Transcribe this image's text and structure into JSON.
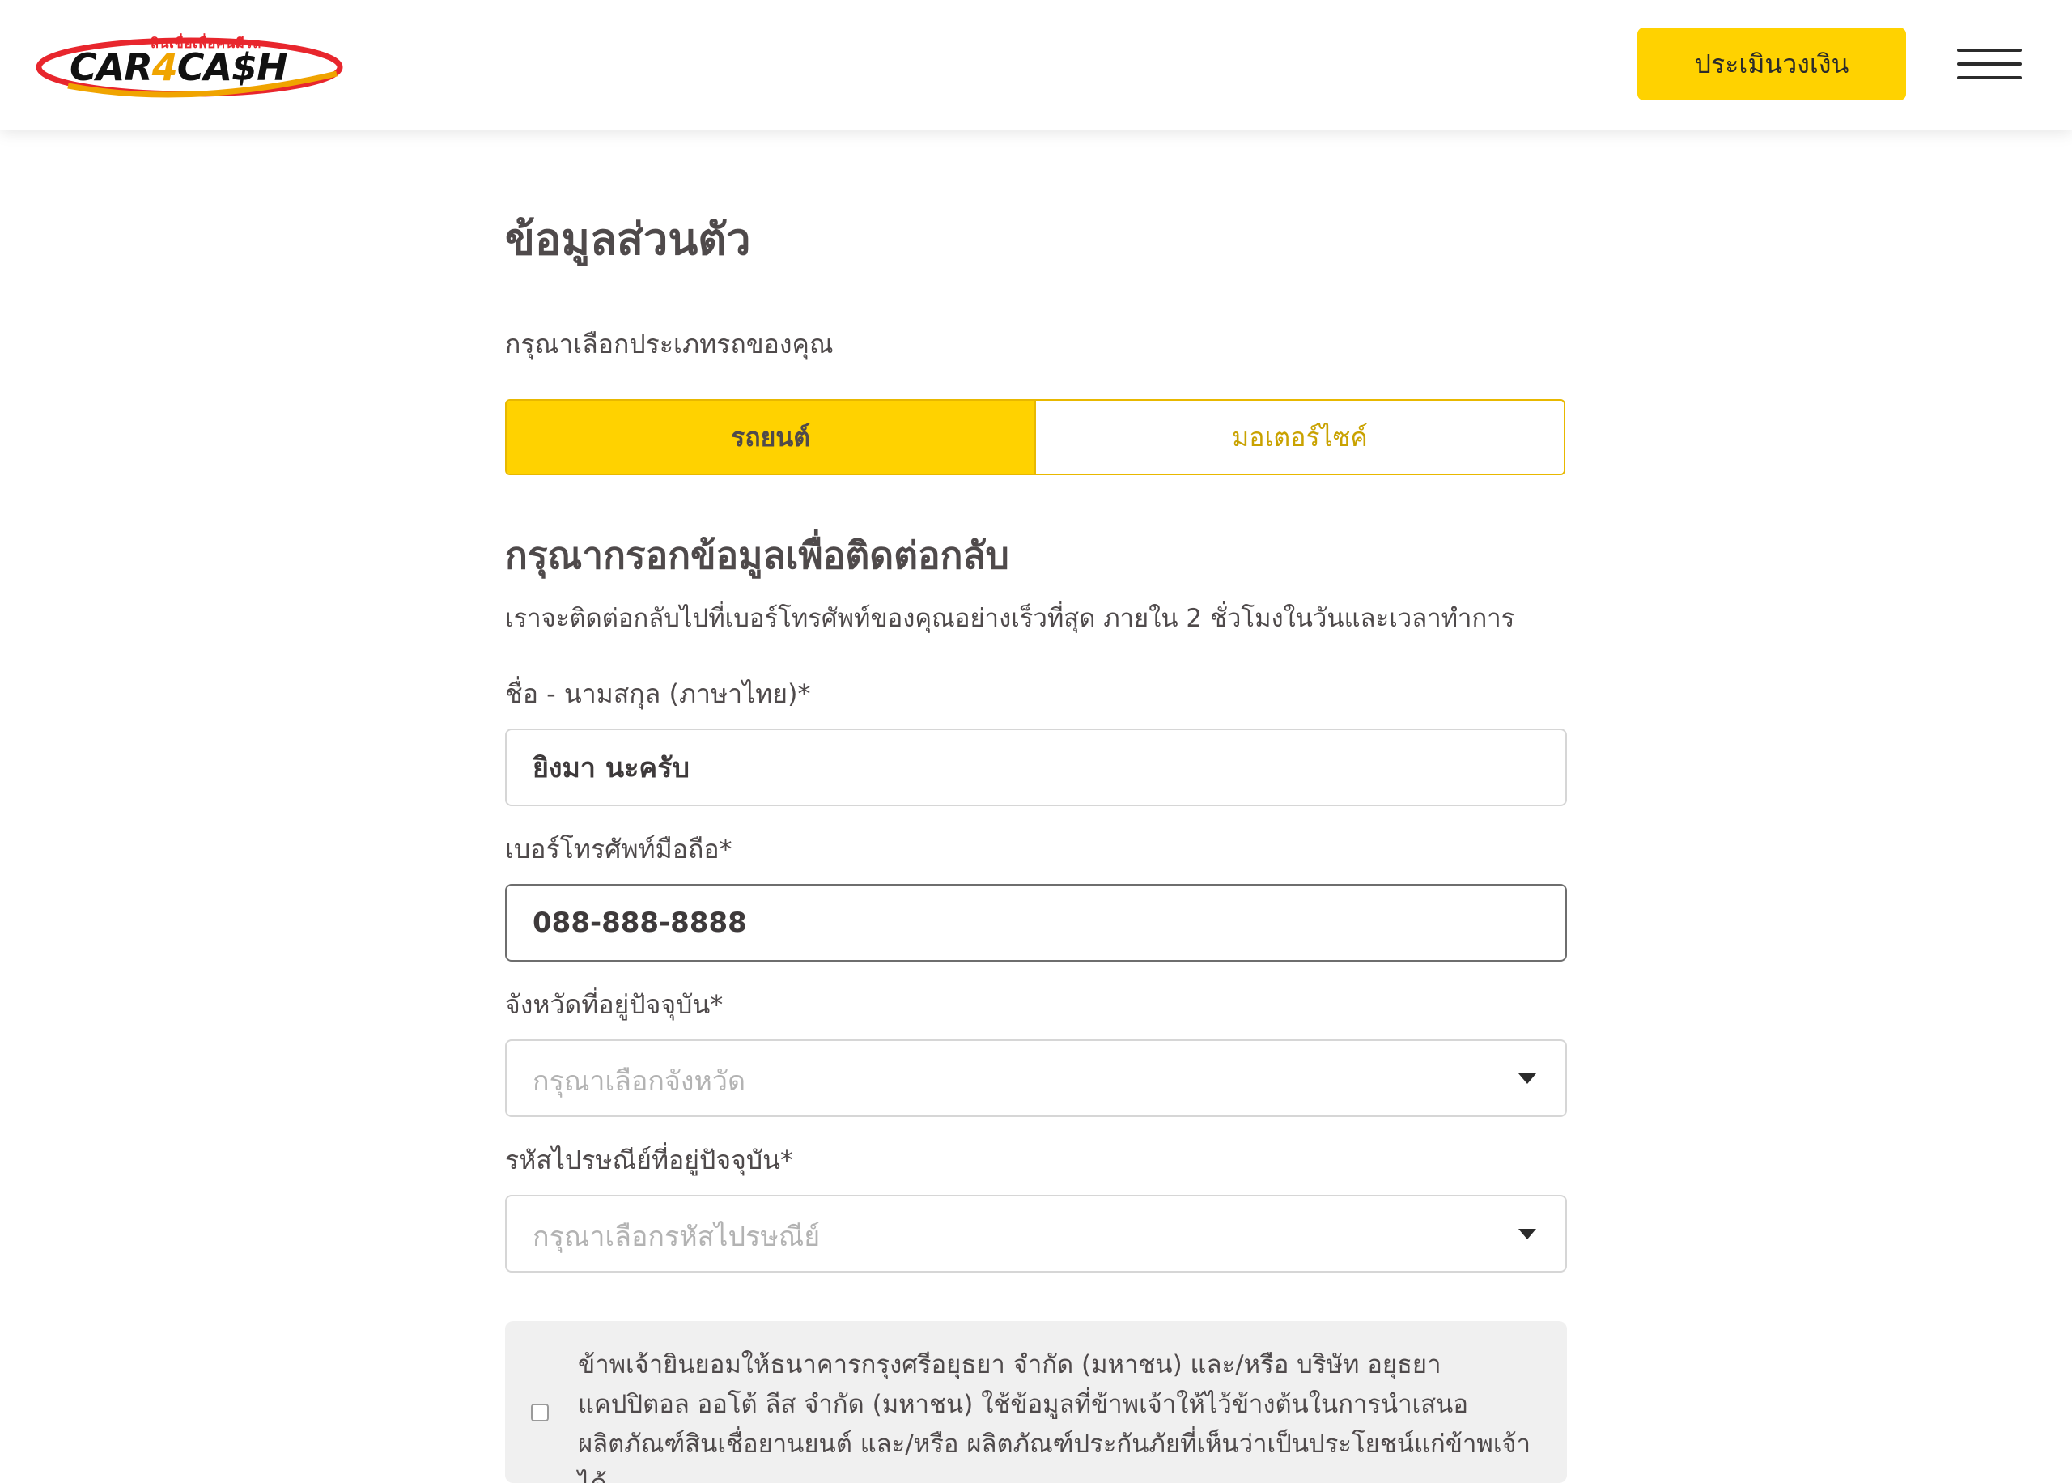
{
  "header": {
    "logo": {
      "tagline": "สินเชื่อเพื่อคนมีรถ",
      "wordmark_part1": "CAR",
      "wordmark_four": "4",
      "wordmark_part2": "CA$H",
      "registered": "®"
    },
    "cta_label": "ประเมินวงเงิน",
    "menu_icon": "hamburger-menu-icon"
  },
  "page": {
    "title": "ข้อมูลส่วนตัว",
    "vehicle_type_label": "กรุณาเลือกประเภทรถของคุณ",
    "vehicle_types": [
      {
        "label": "รถยนต์",
        "selected": true
      },
      {
        "label": "มอเตอร์ไซค์",
        "selected": false
      }
    ],
    "contact_title": "กรุณากรอกข้อมูลเพื่อติดต่อกลับ",
    "contact_subtitle": "เราจะติดต่อกลับไปที่เบอร์โทรศัพท์ของคุณอย่างเร็วที่สุด ภายใน 2 ชั่วโมงในวันและเวลาทำการ"
  },
  "form": {
    "name": {
      "label": "ชื่อ - นามสกุล (ภาษาไทย)*",
      "value": "ยิงมา นะครับ"
    },
    "phone": {
      "label": "เบอร์โทรศัพท์มือถือ*",
      "value": "088-888-8888"
    },
    "province": {
      "label": "จังหวัดที่อยู่ปัจจุบัน*",
      "placeholder": "กรุณาเลือกจังหวัด"
    },
    "postcode": {
      "label": "รหัสไปรษณีย์ที่อยู่ปัจจุบัน*",
      "placeholder": "กรุณาเลือกรหัสไปรษณีย์"
    },
    "consent": {
      "checked": false,
      "text": "ข้าพเจ้ายินยอมให้ธนาคารกรุงศรีอยุธยา จำกัด (มหาชน) และ/หรือ บริษัท อยุธยา แคปปิตอล ออโต้ ลีส จำกัด (มหาชน) ใช้ข้อมูลที่ข้าพเจ้าให้ไว้ข้างต้นในการนำเสนอผลิตภัณฑ์สินเชื่อยานยนต์ และ/หรือ ผลิตภัณฑ์ประกันภัยที่เห็นว่าเป็นประโยชน์แก่ข้าพเจ้าได้"
    }
  },
  "colors": {
    "accent_yellow": "#ffd200",
    "accent_border": "#e8b800",
    "text_primary": "#4f4a4b",
    "logo_red": "#e8262d",
    "logo_orange": "#f0a400"
  }
}
